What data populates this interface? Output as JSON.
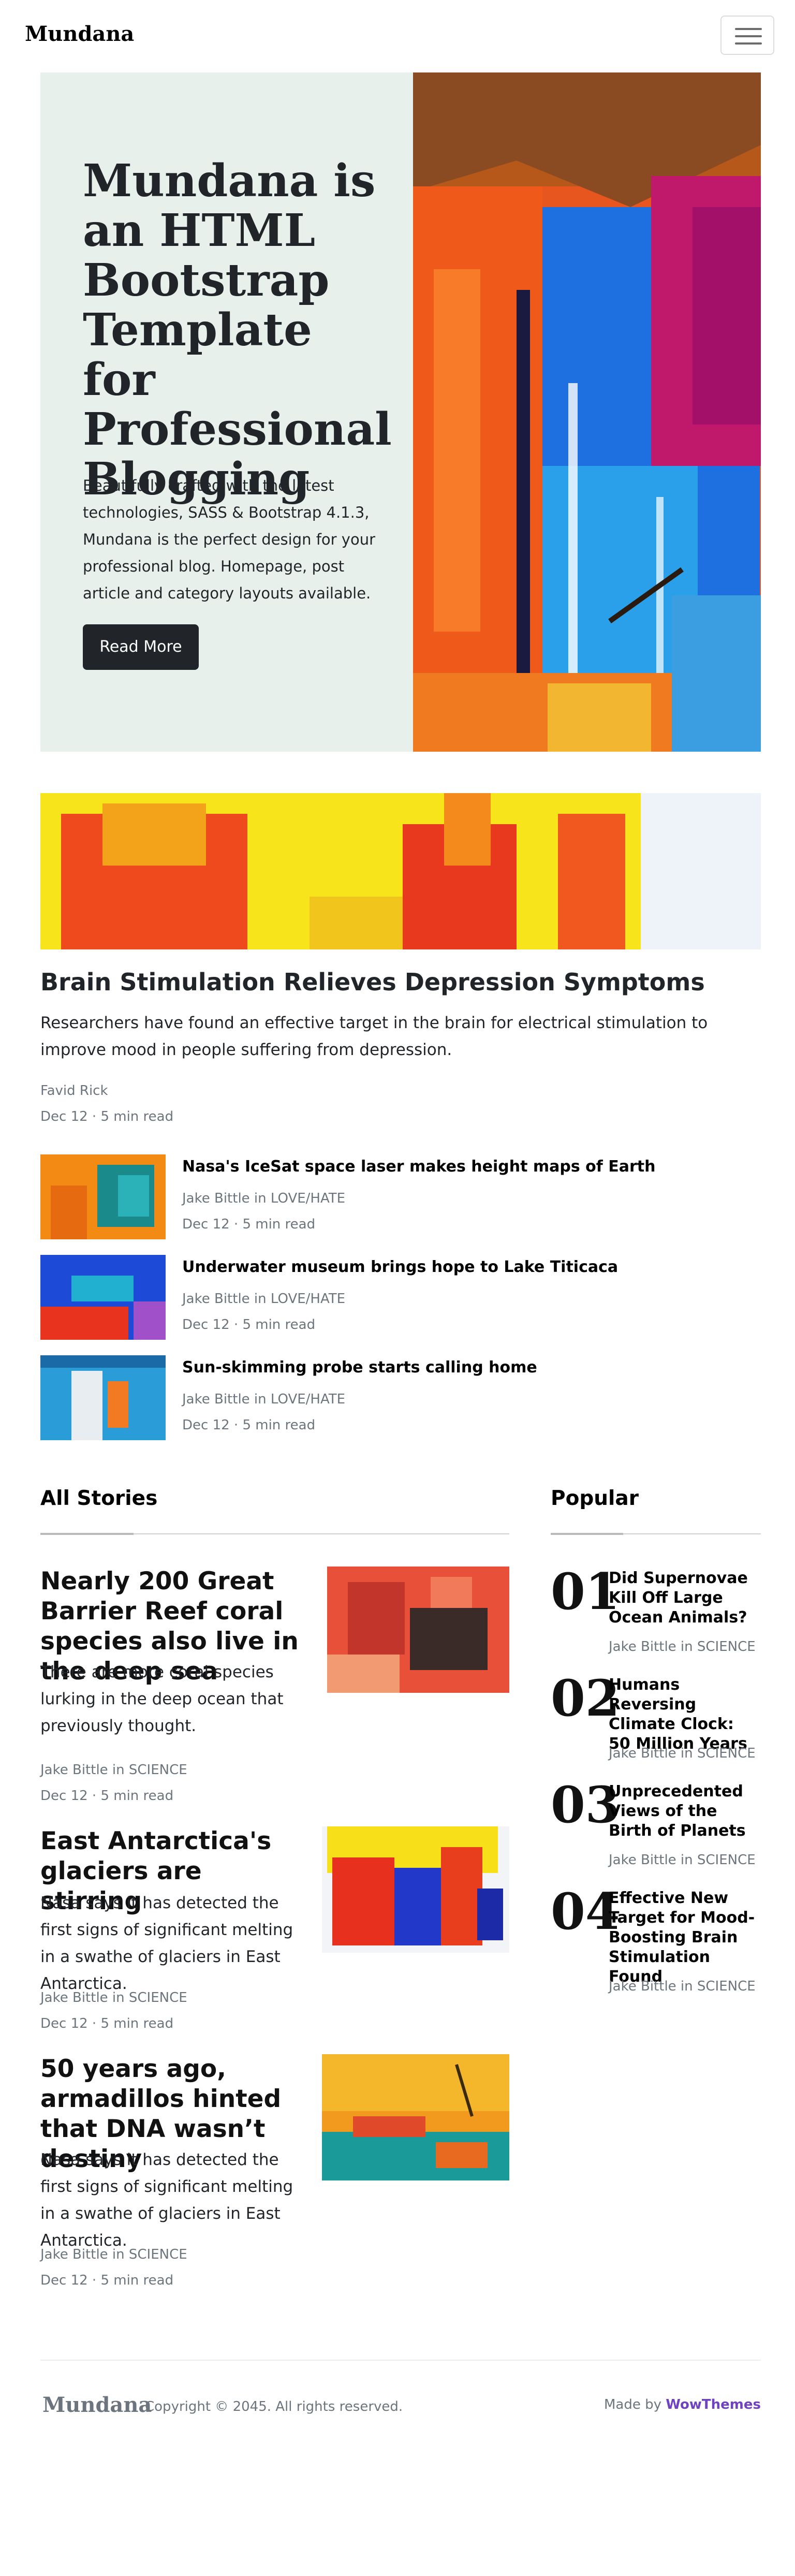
{
  "navbar": {
    "brand": "Mundana",
    "toggler_icon": "hamburger-menu-icon"
  },
  "hero": {
    "title": "Mundana is an HTML Bootstrap Template for Professional Blogging",
    "subtitle": "Beautifully crafted with the latest technologies, SASS & Bootstrap 4.1.3, Mundana is the perfect design for your professional blog. Homepage, post article and category layouts available.",
    "button_label": "Read More",
    "bg_color": "#e8f0eb"
  },
  "featured": {
    "title": "Brain Stimulation Relieves Depression Symptoms",
    "excerpt": "Researchers have found an effective target in the brain for electrical stimulation to improve mood in people suffering from depression.",
    "author": "Favid Rick",
    "date": "Dec 12 · 5 min read"
  },
  "small_posts": [
    {
      "title": "Nasa's IceSat space laser makes height maps of Earth",
      "author": "Jake Bittle in LOVE/HATE",
      "date": "Dec 12 · 5 min read"
    },
    {
      "title": "Underwater museum brings hope to Lake Titicaca",
      "author": "Jake Bittle in LOVE/HATE",
      "date": "Dec 12 · 5 min read"
    },
    {
      "title": "Sun-skimming probe starts calling home",
      "author": "Jake Bittle in LOVE/HATE",
      "date": "Dec 12 · 5 min read"
    }
  ],
  "all_stories": {
    "heading": "All Stories",
    "items": [
      {
        "title": "Nearly 200 Great Barrier Reef coral species also live in the deep sea",
        "excerpt": "There are more coral species lurking in the deep ocean that previously thought.",
        "author": "Jake Bittle in SCIENCE",
        "date": "Dec 12 · 5 min read"
      },
      {
        "title": "East Antarctica's glaciers are stirring",
        "excerpt": "Nasa says it has detected the first signs of significant melting in a swathe of glaciers in East Antarctica.",
        "author": "Jake Bittle in SCIENCE",
        "date": "Dec 12 · 5 min read"
      },
      {
        "title": "50 years ago, armadillos hinted that DNA wasn’t destiny",
        "excerpt": "Nasa says it has detected the first signs of significant melting in a swathe of glaciers in East Antarctica.",
        "author": "Jake Bittle in SCIENCE",
        "date": "Dec 12 · 5 min read"
      }
    ]
  },
  "popular": {
    "heading": "Popular",
    "items": [
      {
        "num": "01",
        "title": "Did Supernovae Kill Off Large Ocean Animals?",
        "author": "Jake Bittle in SCIENCE"
      },
      {
        "num": "02",
        "title": "Humans Reversing Climate Clock: 50 Million Years",
        "author": "Jake Bittle in SCIENCE"
      },
      {
        "num": "03",
        "title": "Unprecedented Views of the Birth of Planets",
        "author": "Jake Bittle in SCIENCE"
      },
      {
        "num": "04",
        "title": "Effective New Target for Mood-Boosting Brain Stimulation Found",
        "author": "Jake Bittle in SCIENCE"
      }
    ]
  },
  "footer": {
    "brand": "Mundana",
    "copyright": "Copyright © 2045. All rights reserved.",
    "made_by_prefix": "Made by",
    "made_by_link": "WowThemes",
    "link_color": "#6f42c1"
  }
}
